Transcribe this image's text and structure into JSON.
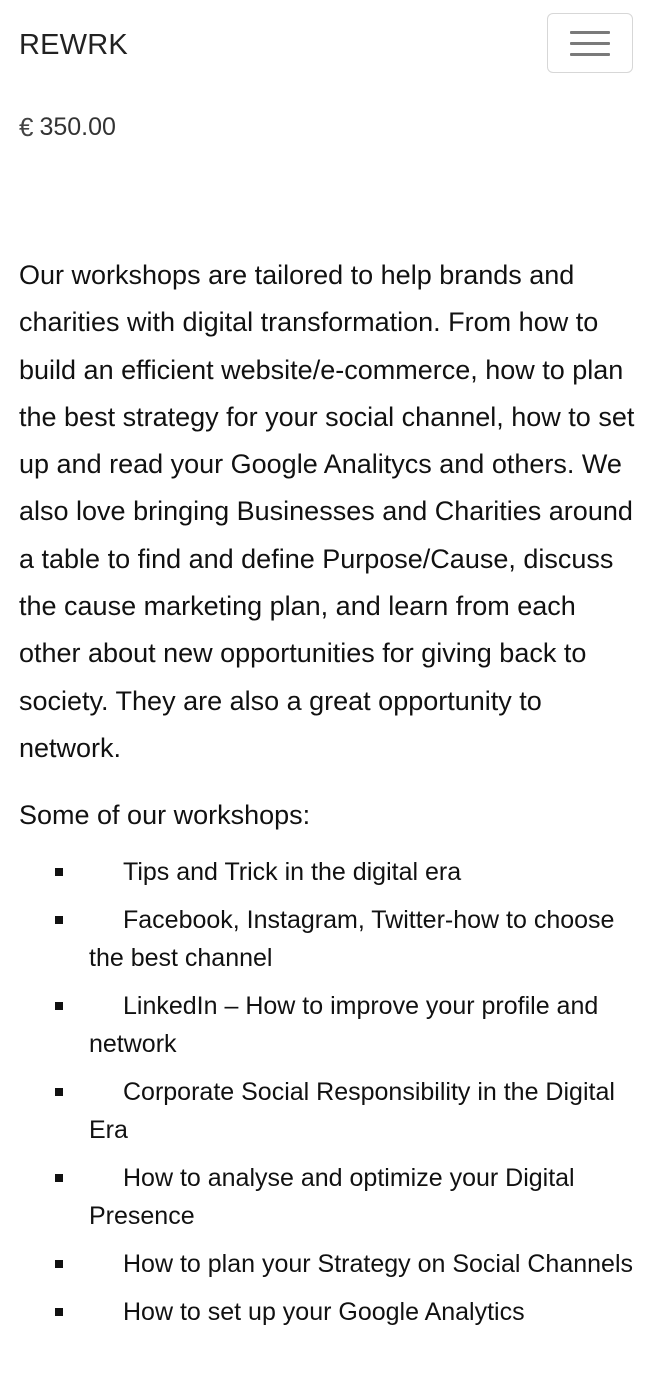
{
  "navbar": {
    "brand": "REWRK",
    "menu_icon": "hamburger-menu-icon"
  },
  "product": {
    "currency_symbol": "€",
    "price": "350.00"
  },
  "description": {
    "intro": "Our workshops are tailored to help brands and charities with digital transformation. From how to build an efficient website/e-commerce, how to plan the best strategy for your social channel, how to set up and read your Google Analitycs and others. We also love bringing Businesses and Charities around a table to find and define Purpose/Cause, discuss the cause marketing plan, and learn from each other about new opportunities for giving back to society. They are also a great opportunity to network.",
    "subheading": "Some of our workshops:",
    "workshops": [
      "Tips and Trick in the digital era",
      "Facebook, Instagram, Twitter-how to choose the best channel",
      "LinkedIn – How to improve your profile and network",
      "Corporate Social Responsibility in the Digital Era",
      "How to analyse and optimize your Digital Presence",
      "How to plan your Strategy on Social Channels",
      "How to set up your Google Analytics"
    ]
  }
}
